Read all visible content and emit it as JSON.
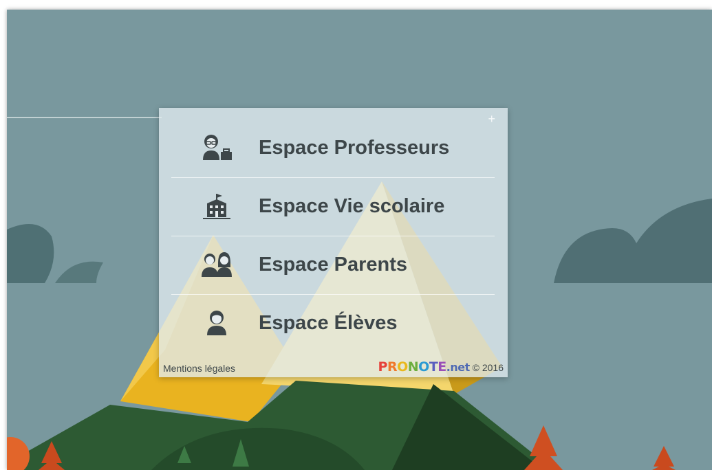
{
  "menu": {
    "items": [
      {
        "label": "Espace Professeurs",
        "icon": "teacher-icon"
      },
      {
        "label": "Espace Vie scolaire",
        "icon": "school-building-icon"
      },
      {
        "label": "Espace Parents",
        "icon": "parents-icon"
      },
      {
        "label": "Espace Élèves",
        "icon": "student-icon"
      }
    ]
  },
  "footer": {
    "legal_label": "Mentions légales",
    "brand_letters": [
      "P",
      "R",
      "O",
      "N",
      "O",
      "T",
      "E"
    ],
    "brand_suffix": ".net",
    "copyright": "© 2016"
  },
  "colors": {
    "background": "#79989e",
    "panel": "#e2ecef",
    "text": "#3d4649",
    "mountain_yellow": "#f0c74b",
    "mountain_green": "#2f5a34"
  }
}
